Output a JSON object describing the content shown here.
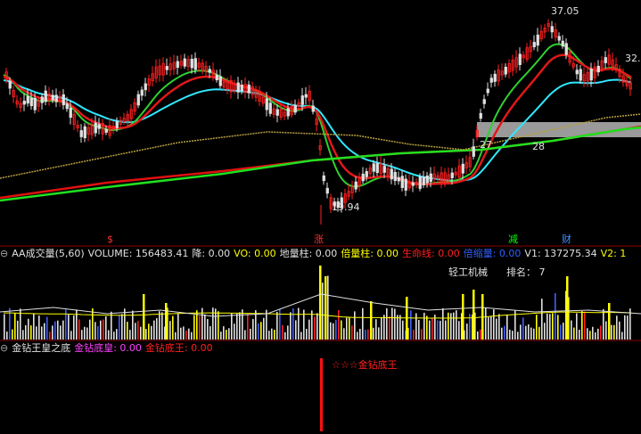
{
  "price_panel": {
    "price_labels": {
      "high": "37.05",
      "low": "19.94",
      "right": "32.",
      "mid_left": "27",
      "mid_right": "28"
    },
    "markers": [
      {
        "text": "$",
        "color": "#ff3030"
      },
      {
        "text": "涨",
        "color": "#ff3030"
      },
      {
        "text": "减",
        "color": "#00ff00"
      },
      {
        "text": "财",
        "color": "#4090ff"
      }
    ]
  },
  "volume_panel": {
    "indicator_name": "AA成交量(5,60)",
    "fields": [
      {
        "label": "VOLUME:",
        "value": "156483.41",
        "color": "#e0e0e0"
      },
      {
        "label": "降:",
        "value": "0.00",
        "color": "#e0e0e0"
      },
      {
        "label": "VO:",
        "value": "0.00",
        "color": "#ffff00"
      },
      {
        "label": "地量柱:",
        "value": "0.00",
        "color": "#e0e0e0"
      },
      {
        "label": "倍量柱:",
        "value": "0.00",
        "color": "#ffff00"
      },
      {
        "label": "生命线:",
        "value": "0.00",
        "color": "#ff2020"
      },
      {
        "label": "倍缩量:",
        "value": "0.00",
        "color": "#3060ff"
      },
      {
        "label": "V1:",
        "value": "137275.34",
        "color": "#e0e0e0"
      },
      {
        "label": "V2:",
        "value": "1",
        "color": "#ffff00"
      }
    ],
    "industry": "轻工机械",
    "rank_label": "排名：",
    "rank_value": "7"
  },
  "bottom_panel": {
    "indicator_name": "金钻王皇之底",
    "fields": [
      {
        "label": "金钻底皇:",
        "value": "0.00",
        "color": "#ff40ff"
      },
      {
        "label": "金钻底王:",
        "value": "0.00",
        "color": "#ff2020"
      }
    ],
    "signal_text": "☆☆☆金钻底王"
  }
}
